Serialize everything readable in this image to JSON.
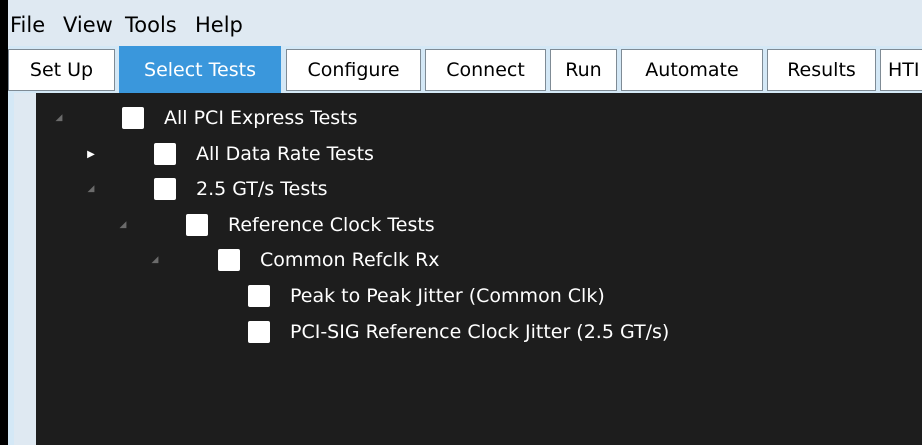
{
  "menubar": {
    "items": [
      "File",
      "View",
      "Tools",
      "Help"
    ]
  },
  "tabs": [
    {
      "label": "Set Up"
    },
    {
      "label": "Select Tests",
      "active": true
    },
    {
      "label": "Configure"
    },
    {
      "label": "Connect"
    },
    {
      "label": "Run"
    },
    {
      "label": "Automate"
    },
    {
      "label": "Results"
    },
    {
      "label": "HTI"
    }
  ],
  "tree": [
    {
      "label": "All PCI Express Tests",
      "depth": 0,
      "state": "expanded",
      "checked": false
    },
    {
      "label": "All Data Rate Tests",
      "depth": 1,
      "state": "collapsed",
      "checked": false
    },
    {
      "label": "2.5 GT/s Tests",
      "depth": 1,
      "state": "expanded",
      "checked": false
    },
    {
      "label": "Reference Clock Tests",
      "depth": 2,
      "state": "expanded",
      "checked": false
    },
    {
      "label": "Common Refclk Rx",
      "depth": 3,
      "state": "expanded",
      "checked": false
    },
    {
      "label": "Peak to Peak Jitter (Common Clk)",
      "depth": 4,
      "state": "leaf",
      "checked": false
    },
    {
      "label": "PCI-SIG Reference Clock Jitter (2.5 GT/s)",
      "depth": 4,
      "state": "leaf",
      "checked": false
    }
  ],
  "colors": {
    "active_tab": "#3a97dc",
    "tree_background": "#1d1d1d"
  }
}
